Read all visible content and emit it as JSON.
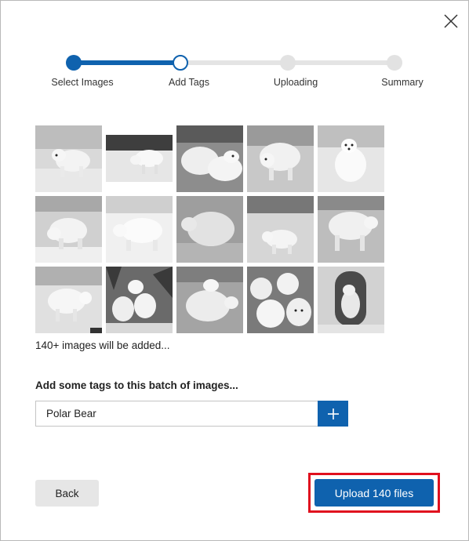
{
  "dialog": {
    "close_icon": "close-icon"
  },
  "stepper": {
    "steps": [
      {
        "label": "Select Images",
        "state": "complete"
      },
      {
        "label": "Add Tags",
        "state": "current"
      },
      {
        "label": "Uploading",
        "state": "pending"
      },
      {
        "label": "Summary",
        "state": "pending"
      }
    ],
    "active_color": "#0f62ae",
    "inactive_color": "#e4e4e4"
  },
  "images": {
    "count": 15,
    "subject": "polar bear photo thumbnails",
    "summary": "140+ images will be added..."
  },
  "tags": {
    "heading": "Add some tags to this batch of images...",
    "input_value": "Polar Bear",
    "add_icon": "plus-icon"
  },
  "footer": {
    "back_label": "Back",
    "upload_label": "Upload 140 files",
    "highlight_color": "#e0101e"
  }
}
